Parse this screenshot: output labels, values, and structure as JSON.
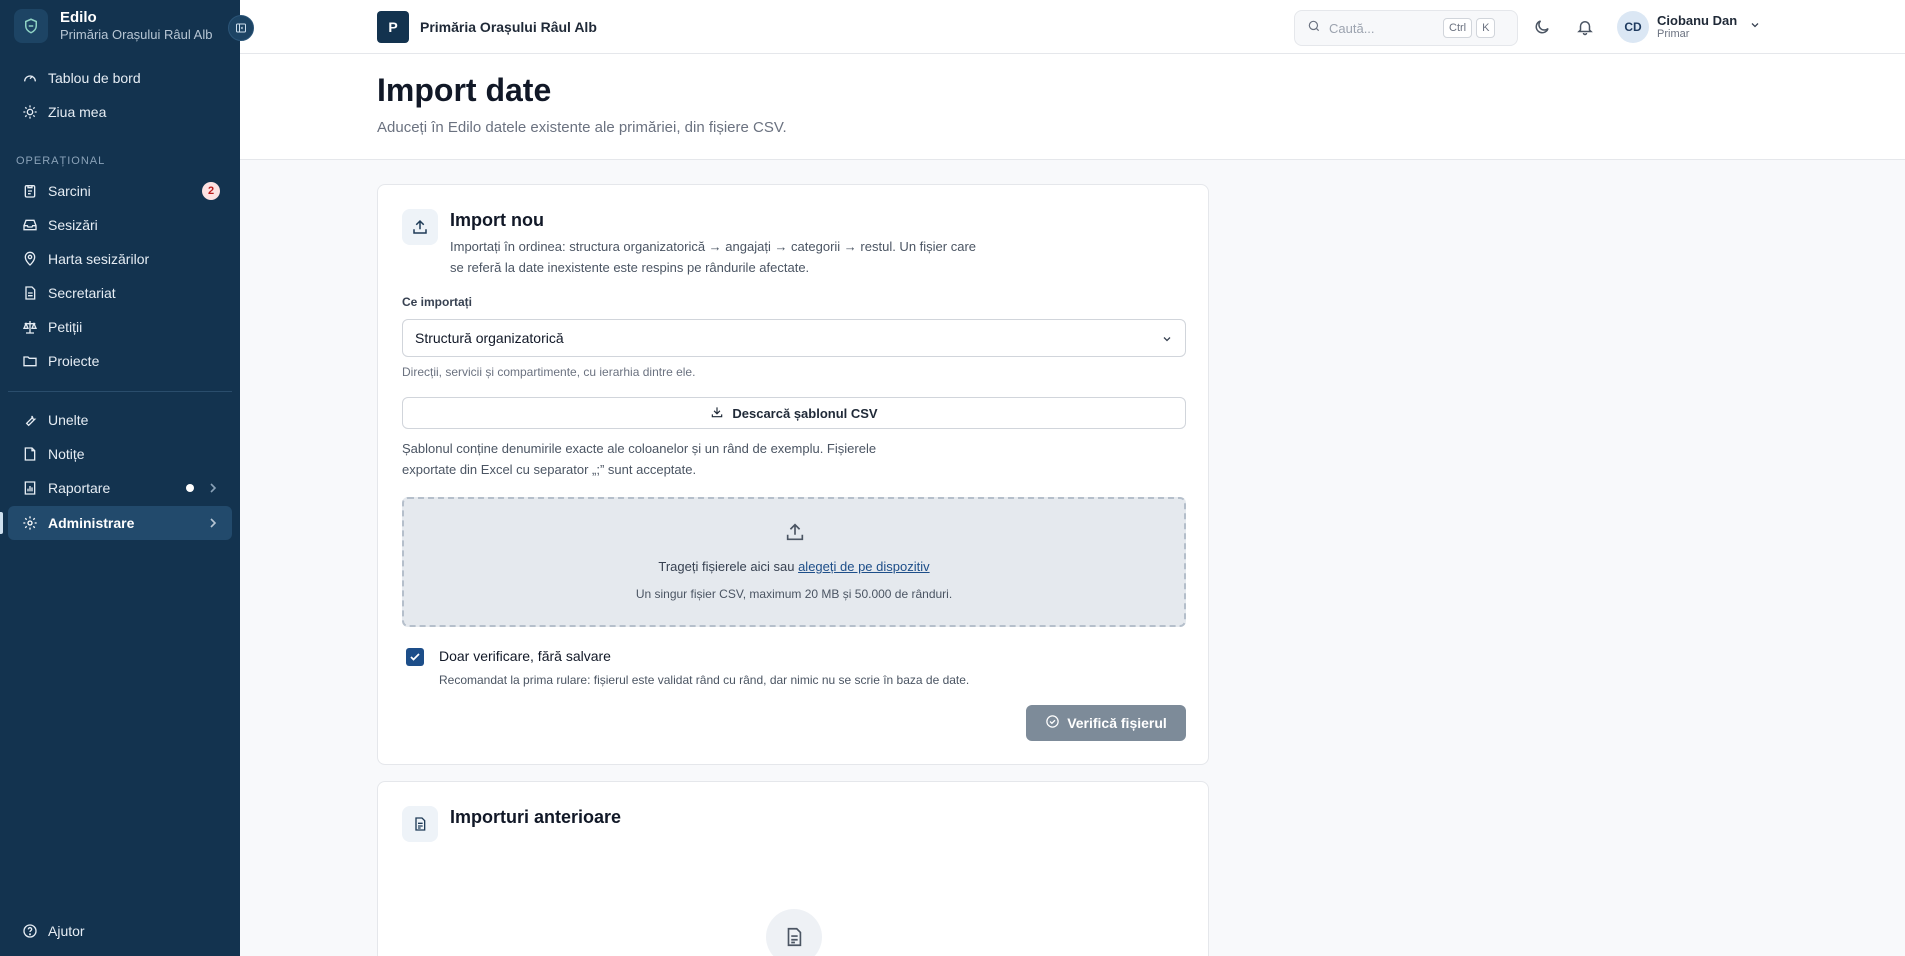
{
  "sidebar": {
    "brand": {
      "name": "Edilo",
      "subtitle": "Primăria Orașului Râul Alb",
      "logo_icon": "shield-icon"
    },
    "collapse_icon": "sidebar-collapse-icon",
    "top_items": [
      {
        "label": "Tablou de bord",
        "icon": "gauge-icon"
      },
      {
        "label": "Ziua mea",
        "icon": "sun-icon"
      }
    ],
    "section_label": "OPERAȚIONAL",
    "ops_items": [
      {
        "label": "Sarcini",
        "icon": "clipboard-icon",
        "badge": "2"
      },
      {
        "label": "Sesizări",
        "icon": "inbox-icon"
      },
      {
        "label": "Harta sesizărilor",
        "icon": "map-pin-icon"
      },
      {
        "label": "Secretariat",
        "icon": "document-icon"
      },
      {
        "label": "Petiții",
        "icon": "scale-icon"
      },
      {
        "label": "Proiecte",
        "icon": "folder-icon"
      }
    ],
    "tool_items": [
      {
        "label": "Unelte",
        "icon": "wrench-icon"
      },
      {
        "label": "Notițe",
        "icon": "note-icon"
      },
      {
        "label": "Raportare",
        "icon": "chart-icon"
      },
      {
        "label": "Administrare",
        "icon": "gear-icon",
        "active": true
      }
    ],
    "help_label": "Ajutor"
  },
  "topbar": {
    "tenant_initial": "P",
    "tenant_name": "Primăria Orașului Râul Alb",
    "search_placeholder": "Caută...",
    "shortcut_key1": "Ctrl",
    "shortcut_key2": "K",
    "user_initials": "CD",
    "user_name": "Ciobanu Dan",
    "user_role": "Primar"
  },
  "page": {
    "title": "Import date",
    "subtitle": "Aduceți în Edilo datele existente ale primăriei, din fișiere CSV."
  },
  "import_card": {
    "title": "Import nou",
    "description": "Importați în ordinea: structura organizatorică → angajați → categorii → restul. Un fișier care se referă la date inexistente este respins pe rândurile afectate.",
    "field_label": "Ce importați",
    "selected_value": "Structură organizatorică",
    "select_hint": "Direcții, servicii și compartimente, cu ierarhia dintre ele.",
    "download_label": "Descarcă șablonul CSV",
    "template_hint": "Șablonul conține denumirile exacte ale coloanelor și un rând de exemplu. Fișierele exportate din Excel cu separator „;” sunt acceptate.",
    "dropzone_text": "Trageți fișierele aici sau",
    "dropzone_link": "alegeți de pe dispozitiv",
    "dropzone_hint": "Un singur fișier CSV, maximum 20 MB și 50.000 de rânduri.",
    "checkbox_label": "Doar verificare, fără salvare",
    "checkbox_checked": true,
    "checkbox_hint": "Recomandat la prima rulare: fișierul este validat rând cu rând, dar nimic nu se scrie în baza de date.",
    "verify_label": "Verifică fișierul"
  },
  "history_card": {
    "title": "Importuri anterioare"
  },
  "colors": {
    "sidebar_bg": "#13334f",
    "accent": "#1d4e89",
    "badge_bg": "#fde2e2",
    "disabled_button": "#7d8b99"
  }
}
